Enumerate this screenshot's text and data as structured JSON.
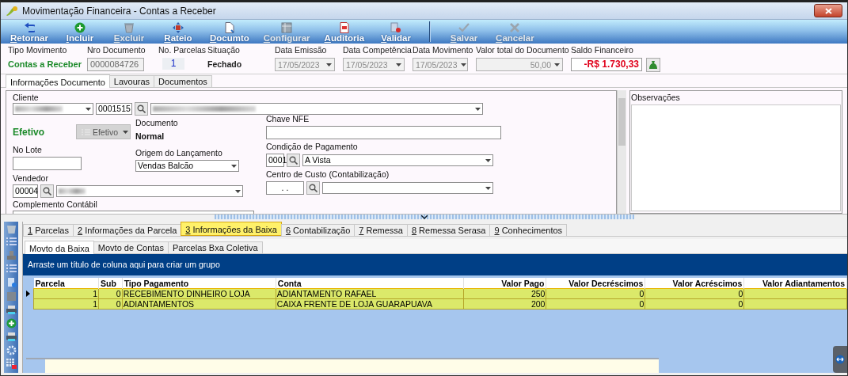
{
  "window": {
    "title": "Movimentação Financeira - Contas a Receber"
  },
  "toolbar": [
    {
      "label": "Retornar",
      "kind": "back",
      "disabled": false
    },
    {
      "label": "Incluir",
      "kind": "add",
      "disabled": false
    },
    {
      "label": "Excluir",
      "kind": "trash",
      "disabled": true
    },
    {
      "label": "Rateio",
      "kind": "split",
      "disabled": false
    },
    {
      "label": "Documto",
      "kind": "document",
      "disabled": false
    },
    {
      "label": "Configurar",
      "kind": "config",
      "disabled": true
    },
    {
      "label": "Auditoria",
      "kind": "report",
      "disabled": false
    },
    {
      "label": "Validar",
      "kind": "validate",
      "disabled": false
    },
    {
      "label": "Salvar",
      "kind": "check",
      "disabled": true,
      "separator_before": true
    },
    {
      "label": "Cancelar",
      "kind": "cancel",
      "disabled": true
    }
  ],
  "header_fields": [
    {
      "label": "Tipo Movimento",
      "value": "Contas a Receber",
      "kind": "status"
    },
    {
      "label": "Nro Documento",
      "value": "0000084726",
      "kind": "input"
    },
    {
      "label": "No. Parcelas",
      "value": "1",
      "kind": "count"
    },
    {
      "label": "Situação",
      "value": "Fechado",
      "kind": "bold"
    },
    {
      "label": "Data Emissão",
      "value": "17/05/2023",
      "kind": "dropdown"
    },
    {
      "label": "Data Competência",
      "value": "17/05/2023",
      "kind": "dropdown"
    },
    {
      "label": "Data Movimento",
      "value": "17/05/2023",
      "kind": "dropdown"
    },
    {
      "label": "Valor total do Documento",
      "value": "50,00",
      "kind": "dropdown"
    },
    {
      "label": "Saldo Financeiro",
      "value": "-R$ 1.730,33",
      "kind": "balance"
    }
  ],
  "document_tabs": [
    {
      "label": "Informações Documento",
      "selected": true
    },
    {
      "label": "Lavouras",
      "selected": false
    },
    {
      "label": "Documentos",
      "selected": false
    }
  ],
  "form": {
    "cliente": {
      "label": "Cliente",
      "code": "0001515"
    },
    "status": {
      "value": "Efetivo",
      "button": "Efetivo",
      "disabled": true
    },
    "documento": {
      "label": "Documento",
      "value": "Normal"
    },
    "chave_nfe": {
      "label": "Chave NFE"
    },
    "no_lote": {
      "label": "No Lote"
    },
    "origem": {
      "label": "Origem do Lançamento",
      "value": "Vendas Balcão"
    },
    "condicao": {
      "label": "Condição de Pagamento",
      "code": "0001",
      "value": "A Vista"
    },
    "vendedor": {
      "label": "Vendedor",
      "code": "00004"
    },
    "centro_custo": {
      "label": "Centro de Custo (Contabilização)",
      "code": ". ."
    },
    "complemento": {
      "label": "Complemento Contábil"
    }
  },
  "observacoes": {
    "label": "Observações"
  },
  "bottom_tabs": [
    {
      "label": "1 Parcelas",
      "selected": false
    },
    {
      "label": "2 Informações da Parcela",
      "selected": false
    },
    {
      "label": "3 Informações da Baixa",
      "selected": true
    },
    {
      "label": "6 Contabilização",
      "selected": false
    },
    {
      "label": "7 Remessa",
      "selected": false
    },
    {
      "label": "8 Remessa Serasa",
      "selected": false
    },
    {
      "label": "9 Conhecimentos",
      "selected": false
    }
  ],
  "sub_tabs": [
    {
      "label": "Movto da Baixa",
      "selected": true
    },
    {
      "label": "Movto de Contas",
      "selected": false
    },
    {
      "label": "Parcelas Bxa Coletiva",
      "selected": false
    }
  ],
  "group_hint": "Arraste um título de coluna aqui para criar um grupo",
  "table": {
    "columns": [
      "Parcela",
      "Sub",
      "Tipo Pagamento",
      "Conta",
      "Valor Pago",
      "Valor Decréscimos",
      "Valor Acréscimos",
      "Valor Adiantamentos"
    ],
    "rows": [
      {
        "selected": true,
        "cells": [
          "1",
          "0",
          "RECEBIMENTO DINHEIRO LOJA",
          "ADIANTAMENTO RAFAEL",
          "250",
          "0",
          "0",
          ""
        ]
      },
      {
        "selected": false,
        "cells": [
          "1",
          "0",
          "ADIANTAMENTOS",
          "CAIXA FRENTE DE LOJA GUARAPUAVA",
          "200",
          "0",
          "0",
          ""
        ]
      }
    ]
  }
}
